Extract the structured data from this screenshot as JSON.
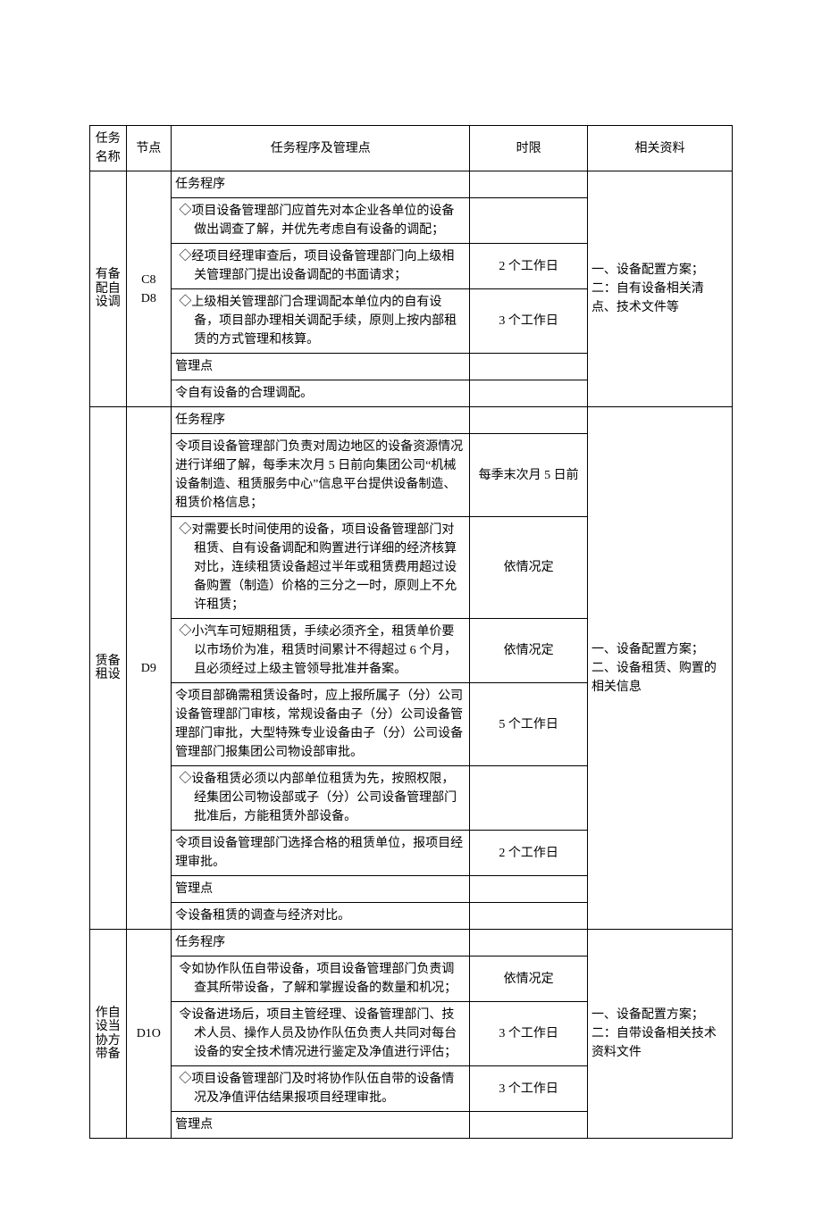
{
  "headers": {
    "task": "任务名称",
    "node": "节点",
    "proc": "任务程序及管理点",
    "time": "时限",
    "ref": "相关资料"
  },
  "sections": [
    {
      "task": "有备配自设调",
      "node": "C8\nD8",
      "ref": "一、设备配置方案；\n二：自有设备相关清点、技术文件等",
      "rows": [
        {
          "proc": "任务程序",
          "time": ""
        },
        {
          "proc": "◇项目设备管理部门应首先对本企业各单位的设备做出调查了解，并优先考虑自有设备的调配；",
          "time": "",
          "indent": true
        },
        {
          "proc": "◇经项目经理审查后，项目设备管理部门向上级相关管理部门提出设备调配的书面请求；",
          "time": "2 个工作日",
          "indent": true
        },
        {
          "proc": "◇上级相关管理部门合理调配本单位内的自有设备，项目部办理相关调配手续，原则上按内部租赁的方式管理和核算。",
          "time": "3 个工作日",
          "indent": true
        },
        {
          "proc": "管理点",
          "time": ""
        },
        {
          "proc": "令自有设备的合理调配。",
          "time": ""
        }
      ]
    },
    {
      "task": "赁备租设",
      "node": "D9",
      "ref": "一、设备配置方案；\n二、设备租赁、购置的相关信息",
      "rows": [
        {
          "proc": "任务程序",
          "time": ""
        },
        {
          "proc": "令项目设备管理部门负责对周边地区的设备资源情况进行详细了解，每季末次月 5 日前向集团公司“机械设备制造、租赁服务中心”信息平台提供设备制造、租赁价格信息；",
          "time": "每季末次月 5 日前"
        },
        {
          "proc": "◇对需要长时间使用的设备，项目设备管理部门对租赁、自有设备调配和购置进行详细的经济核算对比，连续租赁设备超过半年或租赁费用超过设备购置（制造）价格的三分之一时，原则上不允许租赁；",
          "time": "依情况定",
          "indent": true
        },
        {
          "proc": "◇小汽车可短期租赁，手续必须齐全，租赁单价要以市场价为准，租赁时间累计不得超过 6 个月，且必须经过上级主管领导批准并备案。",
          "time": "依情况定",
          "indent": true
        },
        {
          "proc": "令项目部确需租赁设备时，应上报所属子（分）公司设备管理部门审核，常规设备由子（分）公司设备管理部门审批，大型特殊专业设备由子（分）公司设备管理部门报集团公司物设部审批。",
          "time": "5 个工作日"
        },
        {
          "proc": "◇设备租赁必须以内部单位租赁为先，按照权限，经集团公司物设部或子（分）公司设备管理部门批准后，方能租赁外部设备。",
          "time": "",
          "indent": true
        },
        {
          "proc": "令项目设备管理部门选择合格的租赁单位，报项目经理审批。",
          "time": "2 个工作日"
        },
        {
          "proc": "管理点",
          "time": ""
        },
        {
          "proc": "令设备租赁的调查与经济对比。",
          "time": ""
        }
      ]
    },
    {
      "task": "作自设当协方带备",
      "node": "D1O",
      "ref": "一、设备配置方案；\n二：自带设备相关技术资料文件",
      "rows": [
        {
          "proc": "任务程序",
          "time": ""
        },
        {
          "proc": "令如协作队伍自带设备，项目设备管理部门负责调查其所带设备，了解和掌握设备的数量和机况；",
          "time": "依情况定",
          "indent": true
        },
        {
          "proc": "令设备进场后，项目主管经理、设备管理部门、技术人员、操作人员及协作队伍负责人共同对每台设备的安全技术情况进行鉴定及净值进行评估；",
          "time": "3 个工作日",
          "indent": true
        },
        {
          "proc": "◇项目设备管理部门及时将协作队伍自带的设备情况及净值评估结果报项目经理审批。",
          "time": "3 个工作日",
          "indent": true
        },
        {
          "proc": "管理点",
          "time": ""
        }
      ]
    }
  ]
}
